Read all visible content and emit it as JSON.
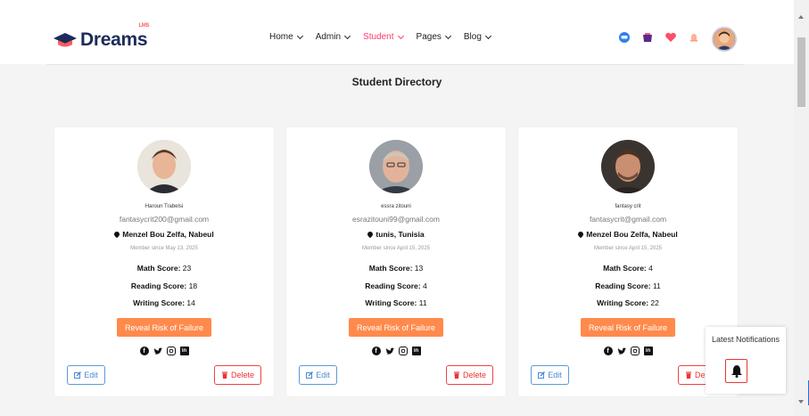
{
  "header": {
    "logo_text": "Dreams",
    "logo_sup": "LMS",
    "nav": [
      {
        "label": "Home",
        "active": false
      },
      {
        "label": "Admin",
        "active": false
      },
      {
        "label": "Student",
        "active": true
      },
      {
        "label": "Pages",
        "active": false
      },
      {
        "label": "Blog",
        "active": false
      }
    ],
    "icons": [
      "message-icon",
      "cart-icon",
      "heart-icon",
      "bell-icon"
    ]
  },
  "page": {
    "title": "Student Directory"
  },
  "students": [
    {
      "name": "Haroun Trabelsi",
      "email": "fantasycrit200@gmail.com",
      "location": "Menzel Bou Zelfa, Nabeul",
      "member_since": "Member since May 13, 2025",
      "math_label": "Math Score:",
      "math": "23",
      "reading_label": "Reading Score:",
      "reading": "18",
      "writing_label": "Writing Score:",
      "writing": "14"
    },
    {
      "name": "essra zitouni",
      "email": "esrazitouni99@gmail.com",
      "location": "tunis, Tunisia",
      "member_since": "Member since April 15, 2025",
      "math_label": "Math Score:",
      "math": "13",
      "reading_label": "Reading Score:",
      "reading": "4",
      "writing_label": "Writing Score:",
      "writing": "11"
    },
    {
      "name": "fantasy crit",
      "email": "fantasycrit@gmail.com",
      "location": "Menzel Bou Zelfa, Nabeul",
      "member_since": "Member since April 15, 2025",
      "math_label": "Math Score:",
      "math": "4",
      "reading_label": "Reading Score:",
      "reading": "11",
      "writing_label": "Writing Score:",
      "writing": "22"
    }
  ],
  "card_actions": {
    "risk_label": "Reveal Risk of Failure",
    "edit_label": "Edit",
    "delete_label": "Delete"
  },
  "notifications": {
    "title": "Latest Notifications"
  },
  "colors": {
    "accent_orange": "#ff8a4c",
    "nav_active": "#ff3b6b",
    "edit_blue": "#4a8ad0",
    "delete_red": "#ee3333",
    "logo_navy": "#1c2b5a"
  }
}
